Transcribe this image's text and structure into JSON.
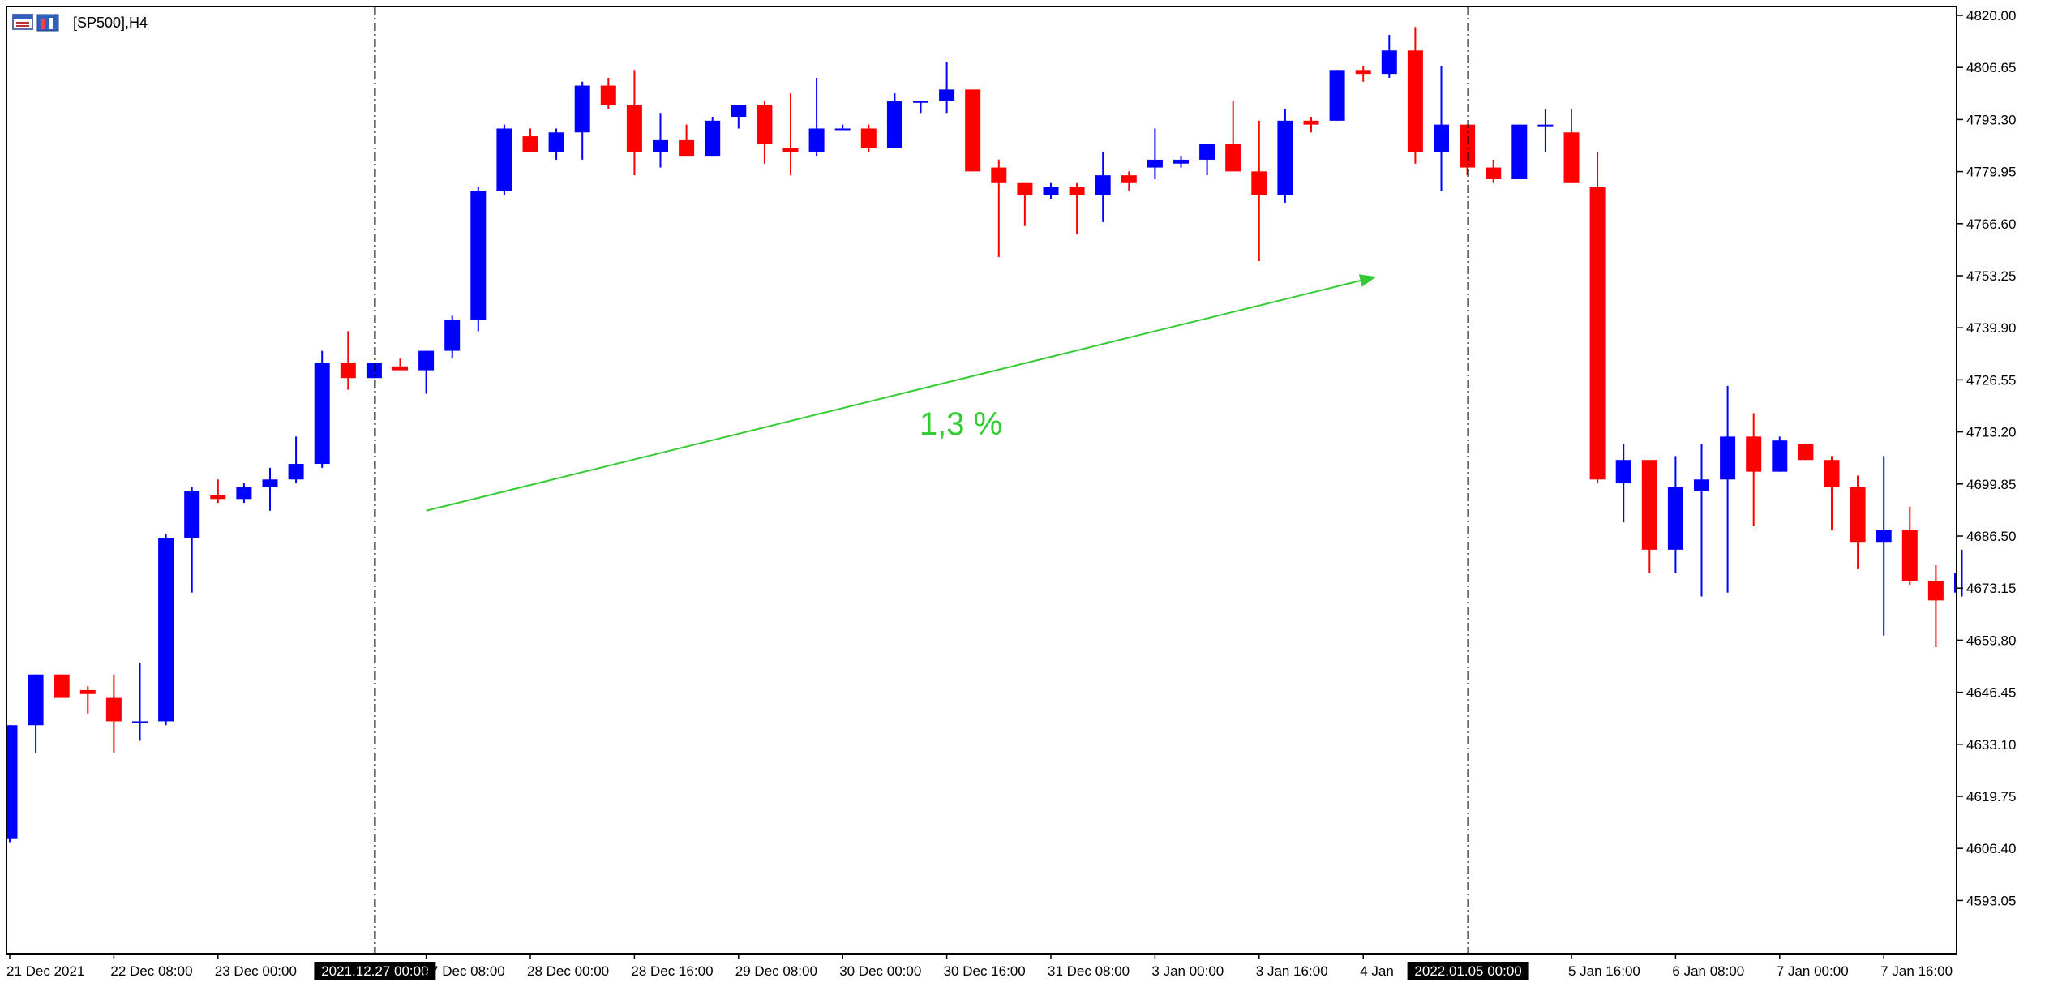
{
  "window": {
    "title": "[SP500],H4",
    "icon": "chart-window-icon"
  },
  "colors": {
    "bull": "#0000ff",
    "bear": "#ff0000",
    "annotation": "#33cc33",
    "frame": "#000000",
    "background": "#ffffff"
  },
  "chart_data": {
    "type": "candlestick",
    "symbol": "SP500",
    "timeframe": "H4",
    "title": "[SP500],H4",
    "grid": false,
    "ylim": [
      4583,
      4823
    ],
    "y_ticks": [
      "4820.00",
      "4806.65",
      "4793.30",
      "4779.95",
      "4766.60",
      "4753.25",
      "4739.90",
      "4726.55",
      "4713.20",
      "4699.85",
      "4686.50",
      "4673.15",
      "4659.80",
      "4646.45",
      "4633.10",
      "4619.75",
      "4606.40",
      "4593.05"
    ],
    "x_ticks": [
      {
        "label": "21 Dec 2021",
        "index": 0
      },
      {
        "label": "22 Dec 08:00",
        "index": 4
      },
      {
        "label": "23 Dec 00:00",
        "index": 8
      },
      {
        "label": "27 Dec 08:00",
        "index": 16
      },
      {
        "label": "28 Dec 00:00",
        "index": 20
      },
      {
        "label": "28 Dec 16:00",
        "index": 24
      },
      {
        "label": "29 Dec 08:00",
        "index": 28
      },
      {
        "label": "30 Dec 00:00",
        "index": 32
      },
      {
        "label": "30 Dec 16:00",
        "index": 36
      },
      {
        "label": "31 Dec 08:00",
        "index": 40
      },
      {
        "label": "3 Jan 00:00",
        "index": 44
      },
      {
        "label": "3 Jan 16:00",
        "index": 48
      },
      {
        "label": "4 Jan",
        "index": 52
      },
      {
        "label": "5 Jan 16:00",
        "index": 60
      },
      {
        "label": "6 Jan 08:00",
        "index": 64
      },
      {
        "label": "7 Jan 00:00",
        "index": 68
      },
      {
        "label": "7 Jan 16:00",
        "index": 72
      }
    ],
    "vertical_markers": [
      {
        "label": "2021.12.27 00:00",
        "index": 14
      },
      {
        "label": "2022.01.05 00:00",
        "index": 56
      }
    ],
    "annotation": {
      "text": "1,3 %",
      "from": {
        "index": 16,
        "price": 4693
      },
      "to": {
        "index": 52.5,
        "price": 4753
      }
    },
    "candles": [
      {
        "o": 4609,
        "h": 4638,
        "l": 4608,
        "c": 4638
      },
      {
        "o": 4638,
        "h": 4651,
        "l": 4631,
        "c": 4651
      },
      {
        "o": 4651,
        "h": 4651,
        "l": 4645,
        "c": 4645
      },
      {
        "o": 4647,
        "h": 4648,
        "l": 4641,
        "c": 4646
      },
      {
        "o": 4645,
        "h": 4651,
        "l": 4631,
        "c": 4639
      },
      {
        "o": 4639,
        "h": 4654,
        "l": 4634,
        "c": 4639
      },
      {
        "o": 4639,
        "h": 4687,
        "l": 4638,
        "c": 4686
      },
      {
        "o": 4686,
        "h": 4699,
        "l": 4672,
        "c": 4698
      },
      {
        "o": 4697,
        "h": 4701,
        "l": 4695,
        "c": 4696
      },
      {
        "o": 4696,
        "h": 4700,
        "l": 4695,
        "c": 4699
      },
      {
        "o": 4699,
        "h": 4704,
        "l": 4693,
        "c": 4701
      },
      {
        "o": 4701,
        "h": 4712,
        "l": 4700,
        "c": 4705
      },
      {
        "o": 4705,
        "h": 4734,
        "l": 4704,
        "c": 4731
      },
      {
        "o": 4731,
        "h": 4739,
        "l": 4724,
        "c": 4727
      },
      {
        "o": 4727,
        "h": 4731,
        "l": 4727,
        "c": 4731
      },
      {
        "o": 4730,
        "h": 4732,
        "l": 4729,
        "c": 4729
      },
      {
        "o": 4729,
        "h": 4734,
        "l": 4723,
        "c": 4734
      },
      {
        "o": 4734,
        "h": 4743,
        "l": 4732,
        "c": 4742
      },
      {
        "o": 4742,
        "h": 4776,
        "l": 4739,
        "c": 4775
      },
      {
        "o": 4775,
        "h": 4792,
        "l": 4774,
        "c": 4791
      },
      {
        "o": 4789,
        "h": 4791,
        "l": 4785,
        "c": 4785
      },
      {
        "o": 4785,
        "h": 4791,
        "l": 4783,
        "c": 4790
      },
      {
        "o": 4790,
        "h": 4803,
        "l": 4783,
        "c": 4802
      },
      {
        "o": 4802,
        "h": 4804,
        "l": 4796,
        "c": 4797
      },
      {
        "o": 4797,
        "h": 4806,
        "l": 4779,
        "c": 4785
      },
      {
        "o": 4785,
        "h": 4795,
        "l": 4781,
        "c": 4788
      },
      {
        "o": 4788,
        "h": 4792,
        "l": 4784,
        "c": 4784
      },
      {
        "o": 4784,
        "h": 4794,
        "l": 4784,
        "c": 4793
      },
      {
        "o": 4794,
        "h": 4797,
        "l": 4791,
        "c": 4797
      },
      {
        "o": 4797,
        "h": 4798,
        "l": 4782,
        "c": 4787
      },
      {
        "o": 4786,
        "h": 4800,
        "l": 4779,
        "c": 4785
      },
      {
        "o": 4785,
        "h": 4804,
        "l": 4784,
        "c": 4791
      },
      {
        "o": 4791,
        "h": 4792,
        "l": 4791,
        "c": 4791
      },
      {
        "o": 4791,
        "h": 4792,
        "l": 4785,
        "c": 4786
      },
      {
        "o": 4786,
        "h": 4800,
        "l": 4786,
        "c": 4798
      },
      {
        "o": 4798,
        "h": 4798,
        "l": 4795,
        "c": 4798
      },
      {
        "o": 4798,
        "h": 4808,
        "l": 4795,
        "c": 4801
      },
      {
        "o": 4801,
        "h": 4801,
        "l": 4780,
        "c": 4780
      },
      {
        "o": 4781,
        "h": 4783,
        "l": 4758,
        "c": 4777
      },
      {
        "o": 4777,
        "h": 4777,
        "l": 4766,
        "c": 4774
      },
      {
        "o": 4774,
        "h": 4777,
        "l": 4773,
        "c": 4776
      },
      {
        "o": 4776,
        "h": 4777,
        "l": 4764,
        "c": 4774
      },
      {
        "o": 4774,
        "h": 4785,
        "l": 4767,
        "c": 4779
      },
      {
        "o": 4779,
        "h": 4780,
        "l": 4775,
        "c": 4777
      },
      {
        "o": 4781,
        "h": 4791,
        "l": 4778,
        "c": 4783
      },
      {
        "o": 4782,
        "h": 4784,
        "l": 4781,
        "c": 4783
      },
      {
        "o": 4783,
        "h": 4787,
        "l": 4779,
        "c": 4787
      },
      {
        "o": 4787,
        "h": 4798,
        "l": 4780,
        "c": 4780
      },
      {
        "o": 4780,
        "h": 4793,
        "l": 4757,
        "c": 4774
      },
      {
        "o": 4774,
        "h": 4796,
        "l": 4772,
        "c": 4793
      },
      {
        "o": 4793,
        "h": 4794,
        "l": 4790,
        "c": 4792
      },
      {
        "o": 4793,
        "h": 4806,
        "l": 4793,
        "c": 4806
      },
      {
        "o": 4806,
        "h": 4807,
        "l": 4803,
        "c": 4805
      },
      {
        "o": 4805,
        "h": 4815,
        "l": 4804,
        "c": 4811
      },
      {
        "o": 4811,
        "h": 4817,
        "l": 4782,
        "c": 4785
      },
      {
        "o": 4785,
        "h": 4807,
        "l": 4775,
        "c": 4792
      },
      {
        "o": 4792,
        "h": 4792,
        "l": 4779,
        "c": 4781
      },
      {
        "o": 4781,
        "h": 4783,
        "l": 4777,
        "c": 4778
      },
      {
        "o": 4778,
        "h": 4792,
        "l": 4778,
        "c": 4792
      },
      {
        "o": 4792,
        "h": 4796,
        "l": 4785,
        "c": 4792
      },
      {
        "o": 4790,
        "h": 4796,
        "l": 4777,
        "c": 4777
      },
      {
        "o": 4776,
        "h": 4785,
        "l": 4700,
        "c": 4701
      },
      {
        "o": 4700,
        "h": 4710,
        "l": 4690,
        "c": 4706
      },
      {
        "o": 4706,
        "h": 4706,
        "l": 4677,
        "c": 4683
      },
      {
        "o": 4683,
        "h": 4707,
        "l": 4677,
        "c": 4699
      },
      {
        "o": 4698,
        "h": 4710,
        "l": 4671,
        "c": 4701
      },
      {
        "o": 4701,
        "h": 4725,
        "l": 4672,
        "c": 4712
      },
      {
        "o": 4712,
        "h": 4718,
        "l": 4689,
        "c": 4703
      },
      {
        "o": 4703,
        "h": 4712,
        "l": 4703,
        "c": 4711
      },
      {
        "o": 4710,
        "h": 4710,
        "l": 4706,
        "c": 4706
      },
      {
        "o": 4706,
        "h": 4707,
        "l": 4688,
        "c": 4699
      },
      {
        "o": 4699,
        "h": 4702,
        "l": 4678,
        "c": 4685
      },
      {
        "o": 4685,
        "h": 4707,
        "l": 4661,
        "c": 4688
      },
      {
        "o": 4688,
        "h": 4694,
        "l": 4674,
        "c": 4675
      },
      {
        "o": 4675,
        "h": 4679,
        "l": 4658,
        "c": 4670
      },
      {
        "o": 4672,
        "h": 4683,
        "l": 4671,
        "c": 4677
      }
    ]
  }
}
